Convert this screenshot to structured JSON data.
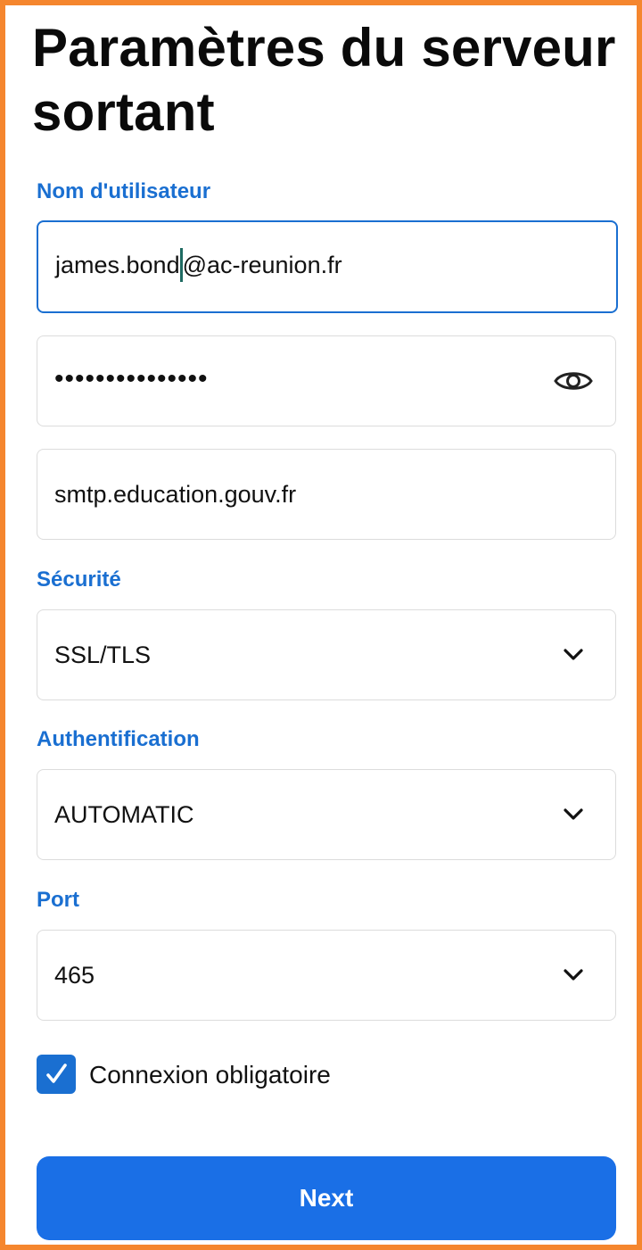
{
  "page": {
    "title": "Paramètres du serveur sortant"
  },
  "username": {
    "label": "Nom d'utilisateur",
    "value_before_caret": "james.bond",
    "value_after_caret": "@ac-reunion.fr"
  },
  "password": {
    "masked_value": "•••••••••••••••",
    "toggle_icon": "eye-icon"
  },
  "server": {
    "value": "smtp.education.gouv.fr"
  },
  "security": {
    "label": "Sécurité",
    "value": "SSL/TLS",
    "icon": "chevron-down-icon"
  },
  "authentication": {
    "label": "Authentification",
    "value": "AUTOMATIC",
    "icon": "chevron-down-icon"
  },
  "port": {
    "label": "Port",
    "value": "465",
    "icon": "chevron-down-icon"
  },
  "login_required": {
    "label": "Connexion obligatoire",
    "checked": true,
    "icon": "checkmark-icon"
  },
  "actions": {
    "next_label": "Next"
  },
  "colors": {
    "accent": "#1a6fd1",
    "button": "#1a6fe6",
    "frame_border": "#f5862e",
    "field_border": "#dcdcdc",
    "caret": "#1f6b62"
  }
}
